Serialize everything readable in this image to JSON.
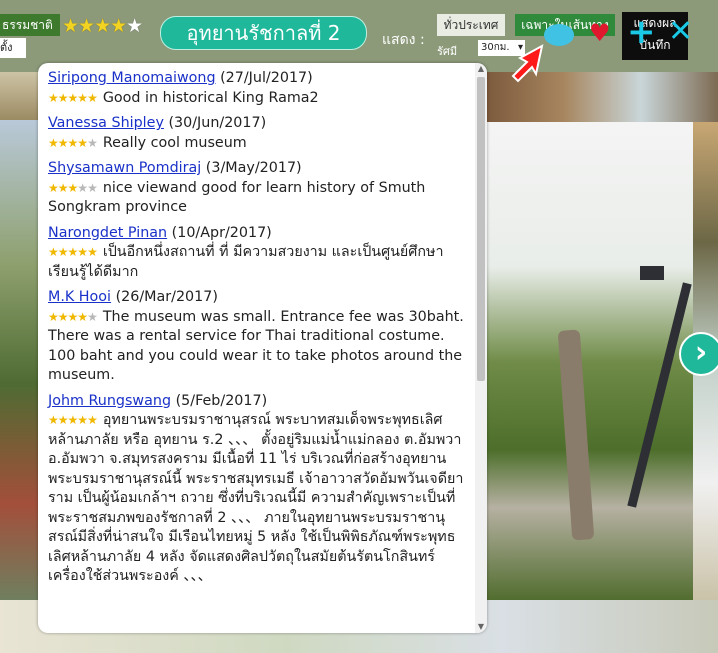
{
  "header": {
    "category_tag": "ธรรมชาติ",
    "rating_stars": 4,
    "sub_tab": "ตั้ง",
    "title": "อุทยานรัชกาลที่ 2",
    "show_label": "แสดง :",
    "filter_all": "ทั่วประเทศ",
    "filter_only": "เฉพาะในเส้นทาง",
    "radius_label": "รัศมี",
    "radius_value": "30กม.",
    "show_button_line1": "แสดงผล",
    "show_button_line2": "บันทึก"
  },
  "icons": {
    "comment": "speech-bubble-icon",
    "favorite": "heart-icon",
    "add": "plus-icon",
    "close": "close-icon",
    "pointer": "red-arrow-icon",
    "next": "chevron-right-icon"
  },
  "colors": {
    "title_pill": "#1fb89b",
    "icon_cyan": "#19c9e6",
    "heart": "#e0182d",
    "link": "#1a31c9",
    "star": "#f0b800"
  },
  "reviews": [
    {
      "name": "Siripong Manomaiwong",
      "date": "(27/Jul/2017)",
      "stars": 5,
      "text": "Good in historical King Rama2"
    },
    {
      "name": "Vanessa Shipley",
      "date": "(30/Jun/2017)",
      "stars": 4,
      "text": "Really cool museum"
    },
    {
      "name": "Shysamawn Pomdiraj",
      "date": "(3/May/2017)",
      "stars": 3,
      "text": "nice viewand good for learn history of Smuth Songkram province"
    },
    {
      "name": "Narongdet Pinan",
      "date": "(10/Apr/2017)",
      "stars": 5,
      "text": "เป็นอีกหนึ่งสถานที่ ที่ มีความสวยงาม และเป็นศูนย์ศึกษาเรียนรู้ได้ดีมาก"
    },
    {
      "name": "M.K Hooi",
      "date": "(26/Mar/2017)",
      "stars": 4,
      "text": "The museum was small. Entrance fee was 30baht. There was a rental service for Thai traditional costume. 100 baht and you could wear it to take photos around the museum."
    },
    {
      "name": "Johm Rungswang",
      "date": "(5/Feb/2017)",
      "stars": 5,
      "text": "อุทยานพระบรมราชานุสรณ์ พระบาทสมเด็จพระพุทธเลิศหล้านภาลัย หรือ อุทยาน ร.2 、、、 ตั้งอยู่ริมแม่น้ำแม่กลอง ต.อัมพวา อ.อัมพวา จ.สมุทรสงคราม มีเนื้อที่ 11 ไร่ บริเวณที่ก่อสร้างอุทยานพระบรมราชานุสรณ์นี้ พระราชสมุทรเมธี เจ้าอาวาสวัดอัมพวันเจดียาราม เป็นผู้น้อมเกล้าฯ ถวาย ซึ่งที่บริเวณนี้มี ความสำคัญเพราะเป็นที่พระราชสมภพของรัชกาลที่ 2 、、、 ภายในอุทยานพระบรมราชานุสรณ์มีสิ่งที่น่าสนใจ มีเรือนไทยหมู่ 5 หลัง ใช้เป็นพิพิธภัณฑ์พระพุทธเลิศหล้านภาลัย 4 หลัง จัดแสดงศิลปวัตถุในสมัยต้นรัตนโกสินทร์ เครื่องใช้ส่วนพระองค์ 、、、"
    }
  ]
}
